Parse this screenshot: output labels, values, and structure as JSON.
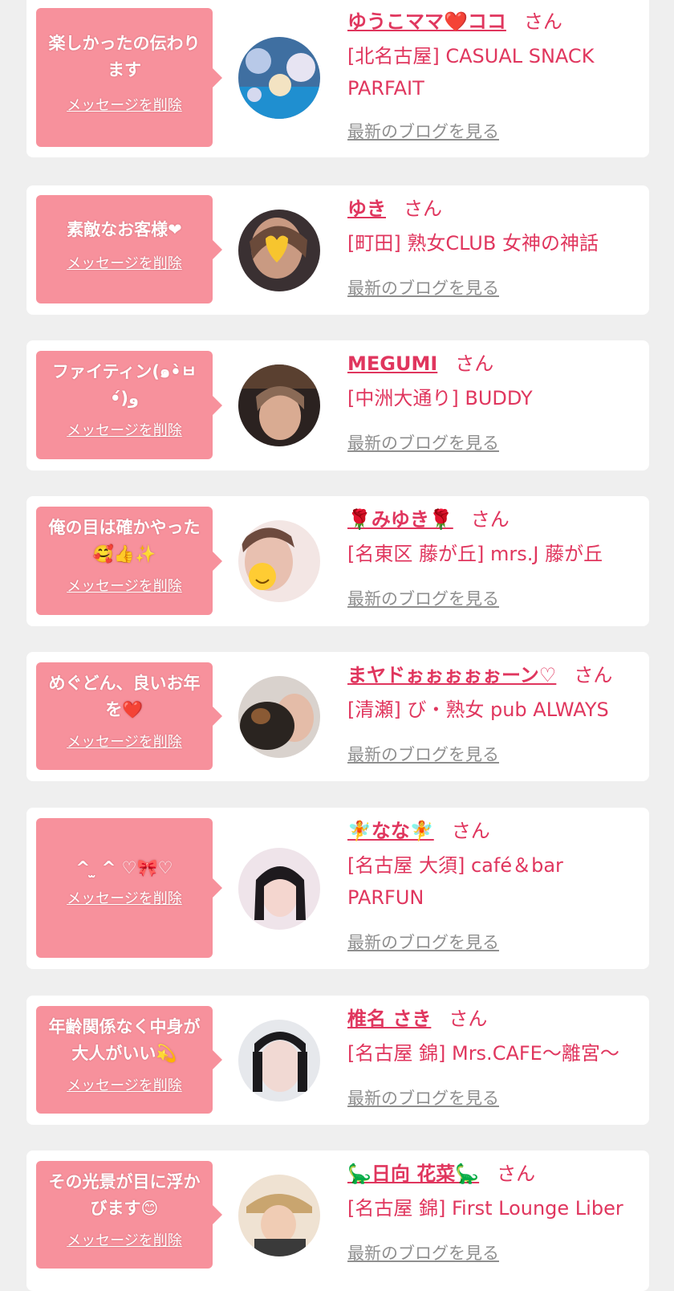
{
  "common": {
    "delete_label": "メッセージを削除",
    "blog_label": "最新のブログを見る",
    "honorific": "さん"
  },
  "messages": [
    {
      "message": "楽しかったの伝わります",
      "name": "ゆうこママ❤️ココ",
      "shop": "[北名古屋] CASUAL SNACK PARFAIT",
      "avatar_icon": "photo-avatar-icon"
    },
    {
      "message": "素敵なお客様❤",
      "name": "ゆき",
      "shop": "[町田] 熟女CLUB 女神の神話",
      "avatar_icon": "photo-avatar-icon"
    },
    {
      "message": "ファイティン(๑•̀ㅂ•́)و",
      "name": "MEGUMI",
      "shop": "[中洲大通り] BUDDY",
      "avatar_icon": "photo-avatar-icon"
    },
    {
      "message": "俺の目は確かやった🥰👍✨",
      "name": "🌹みゆき🌹",
      "shop": "[名東区 藤が丘] mrs.J 藤が丘",
      "avatar_icon": "photo-avatar-icon"
    },
    {
      "message": "めぐどん、良いお年を❤️",
      "name": "まヤドぉぉぉぉぉーン♡",
      "shop": "[清瀬] び・熟女 pub ALWAYS",
      "avatar_icon": "photo-avatar-icon"
    },
    {
      "message": "^ ̫ ^ ♡🎀♡",
      "name": "🧚なな🧚",
      "shop": "[名古屋 大須] café＆bar PARFUN",
      "avatar_icon": "photo-avatar-icon"
    },
    {
      "message": "年齢関係なく中身が大人がいい💫",
      "name": "椎名 さき",
      "shop": "[名古屋 錦] Mrs.CAFE〜離宮〜",
      "avatar_icon": "photo-avatar-icon"
    },
    {
      "message": "その光景が目に浮かびます😊",
      "name": "🦕日向 花菜🦕",
      "shop": "[名古屋 錦] First Lounge Liber",
      "avatar_icon": "photo-avatar-icon"
    }
  ]
}
